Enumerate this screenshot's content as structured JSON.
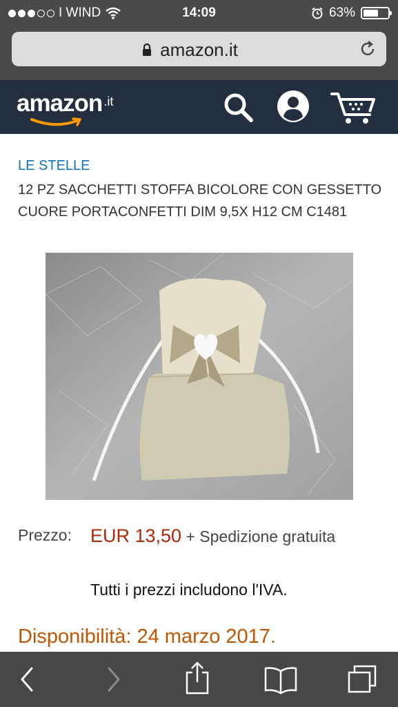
{
  "status_bar": {
    "carrier": "I WIND",
    "time": "14:09",
    "battery": "63%",
    "battery_level": 0.63,
    "signal_bars_filled": 3,
    "signal_bars_total": 5
  },
  "browser": {
    "url": "amazon.it"
  },
  "amazon_header": {
    "logo_word": "amazon",
    "logo_tld": ".it"
  },
  "product": {
    "brand": "LE STELLE",
    "title": "12 PZ SACCHETTI STOFFA BICOLORE CON GESSETTO CUORE PORTACONFETTI DIM 9,5X H12 CM C1481",
    "price_label": "Prezzo:",
    "price": "EUR 13,50",
    "shipping": "+ Spedizione gratuita",
    "vat_note": "Tutti i prezzi includono l'IVA.",
    "availability": "Disponibilità: 24 marzo 2017."
  },
  "colors": {
    "brand_link": "#0f73b9",
    "price": "#b12704",
    "availability": "#c45500",
    "header_bg": "#232f3e",
    "smile": "#ff9900"
  }
}
